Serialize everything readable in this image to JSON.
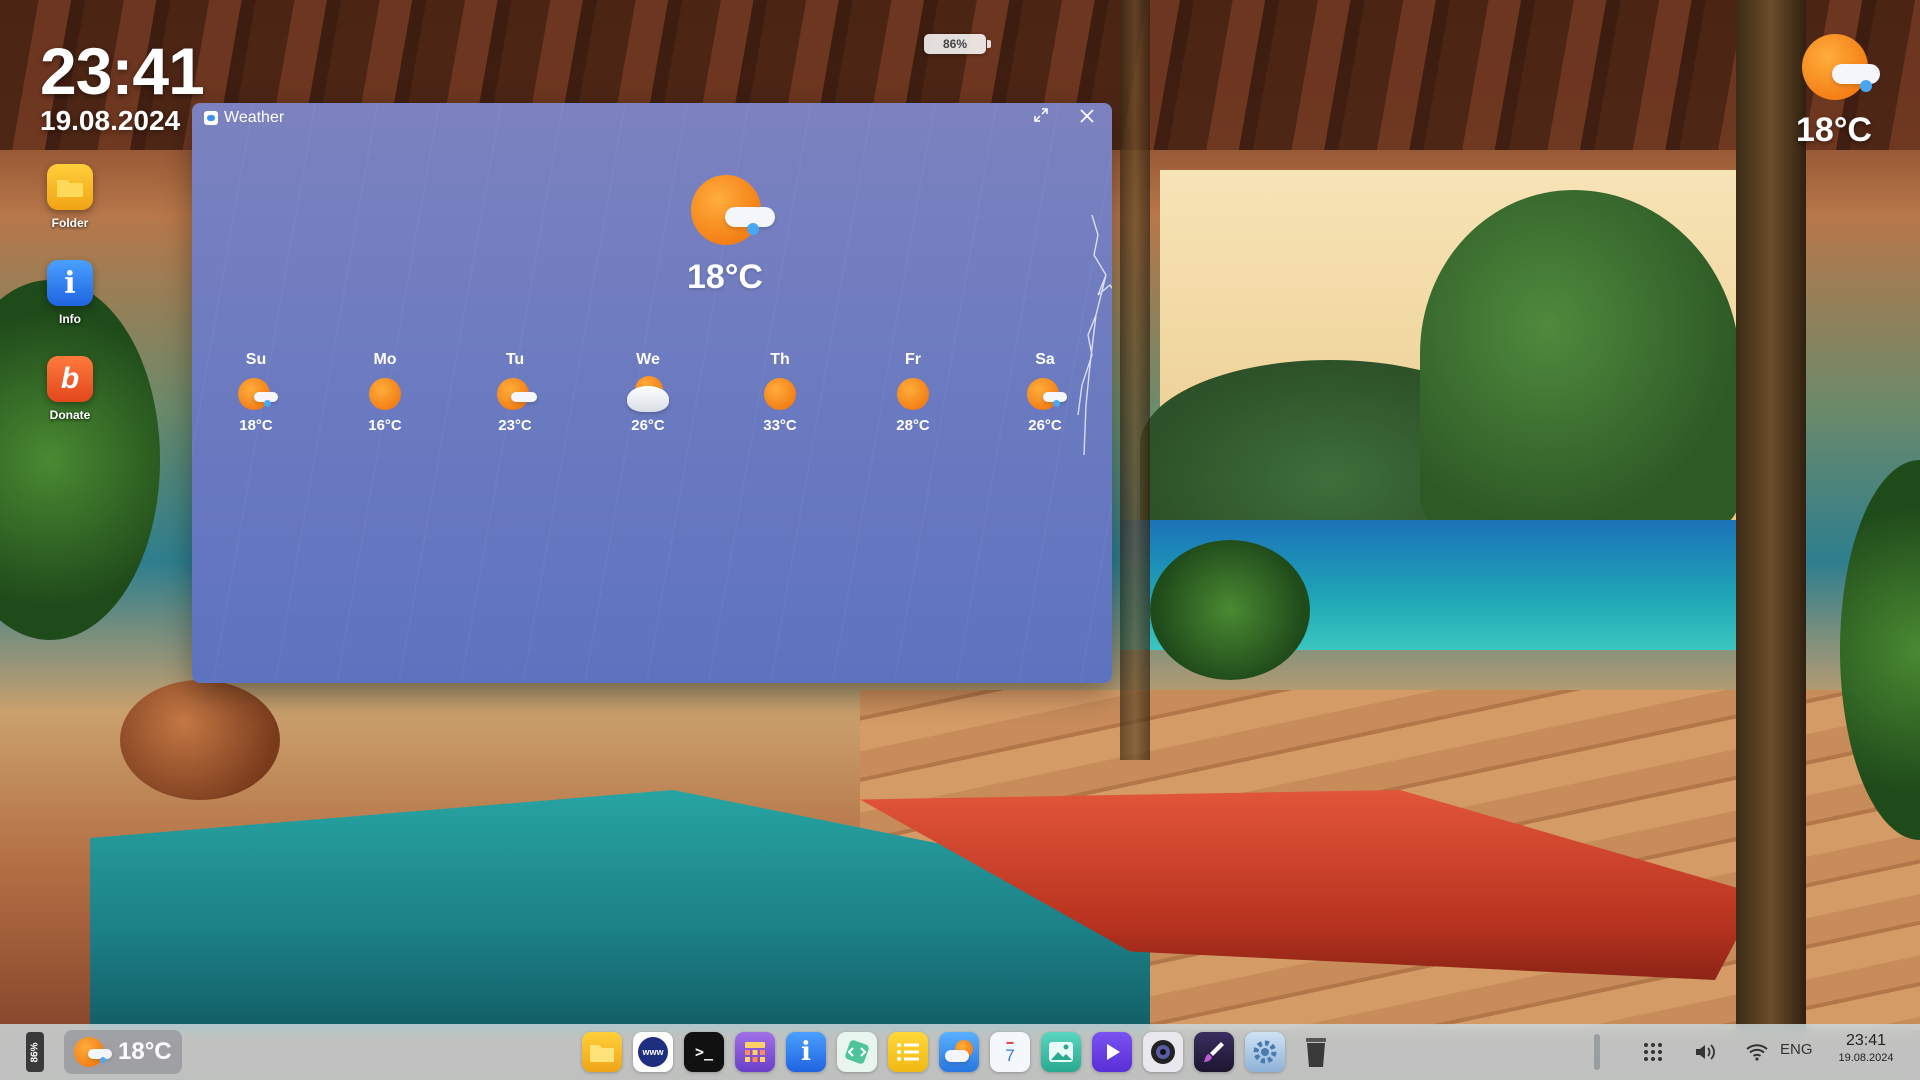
{
  "desktop": {
    "clock_time": "23:41",
    "clock_date": "19.08.2024",
    "icons": [
      {
        "label": "Folder",
        "icon": "folder-icon",
        "color": "#f5b41a"
      },
      {
        "label": "Info",
        "icon": "info-icon",
        "color": "#2f7cf0"
      },
      {
        "label": "Donate",
        "icon": "donate-icon",
        "color": "#f0622a"
      }
    ],
    "top_battery": "86%",
    "top_right_weather_temp": "18°C"
  },
  "weather_window": {
    "title": "Weather",
    "current_temp": "18°C",
    "current_icon": "sun-cloud-rain-icon",
    "forecast": [
      {
        "day": "Su",
        "temp": "18°C",
        "icon": "sun-cloud-rain-icon"
      },
      {
        "day": "Mo",
        "temp": "16°C",
        "icon": "sun-icon"
      },
      {
        "day": "Tu",
        "temp": "23°C",
        "icon": "sun-cloud-icon"
      },
      {
        "day": "We",
        "temp": "26°C",
        "icon": "cloud-sun-icon"
      },
      {
        "day": "Th",
        "temp": "33°C",
        "icon": "sun-icon"
      },
      {
        "day": "Fr",
        "temp": "28°C",
        "icon": "sun-icon"
      },
      {
        "day": "Sa",
        "temp": "26°C",
        "icon": "sun-cloud-rain-icon"
      }
    ]
  },
  "taskbar": {
    "battery": "86%",
    "weather_temp": "18°C",
    "dock_apps": [
      {
        "name": "files",
        "icon": "folder-icon",
        "color": "#f5b41a"
      },
      {
        "name": "browser",
        "icon": "globe-icon",
        "color": "#2b3a8a",
        "text": "www"
      },
      {
        "name": "terminal",
        "icon": "terminal-icon",
        "color": "#111111",
        "text": ">_"
      },
      {
        "name": "calculator",
        "icon": "calculator-icon",
        "color": "#8a5ad6"
      },
      {
        "name": "info",
        "icon": "info-icon",
        "color": "#2f7cf0",
        "text": "i"
      },
      {
        "name": "code",
        "icon": "code-icon",
        "color": "#4fc39a"
      },
      {
        "name": "notes",
        "icon": "list-icon",
        "color": "#f3c218"
      },
      {
        "name": "weather",
        "icon": "weather-icon",
        "color": "#3a8ff0"
      },
      {
        "name": "calendar",
        "icon": "calendar-icon",
        "color": "#f4f7fb",
        "text": "7"
      },
      {
        "name": "photos",
        "icon": "image-icon",
        "color": "#3ec3a6"
      },
      {
        "name": "video",
        "icon": "play-icon",
        "color": "#6a3fe0"
      },
      {
        "name": "camera",
        "icon": "camera-icon",
        "color": "#2b2b3a"
      },
      {
        "name": "paint",
        "icon": "brush-icon",
        "color": "#2a2440"
      },
      {
        "name": "settings",
        "icon": "gear-icon",
        "color": "#9fbfe0"
      },
      {
        "name": "trash",
        "icon": "trash-icon",
        "color": "#3a3a3a"
      }
    ],
    "lang": "ENG",
    "tray_time": "23:41",
    "tray_date": "19.08.2024"
  }
}
